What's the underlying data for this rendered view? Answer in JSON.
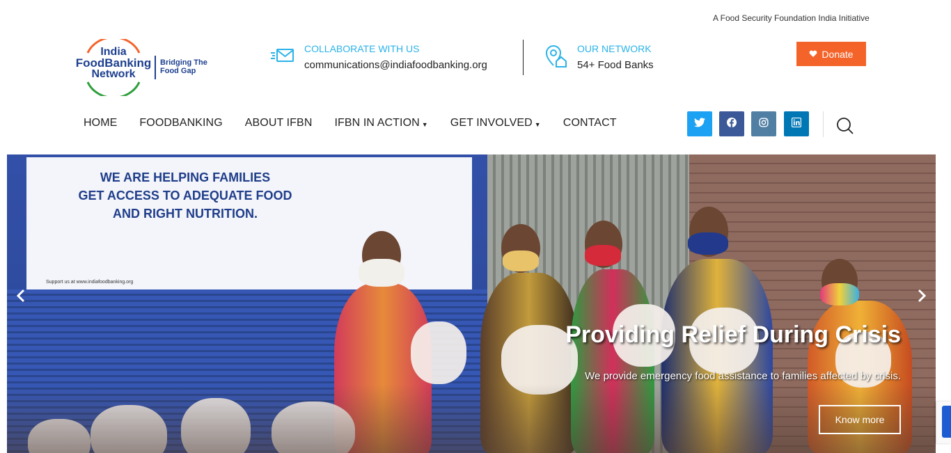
{
  "header": {
    "tagline": "A Food Security Foundation India Initiative",
    "logo": {
      "line1": "India",
      "line2": "FoodBanking",
      "line3": "Network",
      "tag1": "Bridging The",
      "tag2": "Food Gap"
    },
    "collaborate": {
      "title": "COLLABORATE WITH US",
      "value": "communications@indiafoodbanking.org",
      "icon": "email-icon"
    },
    "network": {
      "title": "OUR NETWORK",
      "value": "54+ Food Banks",
      "icon": "location-home-icon"
    },
    "donate_label": "Donate"
  },
  "nav": {
    "items": [
      {
        "label": "HOME",
        "dropdown": false
      },
      {
        "label": "FOODBANKING",
        "dropdown": false
      },
      {
        "label": "ABOUT IFBN",
        "dropdown": false
      },
      {
        "label": "IFBN IN ACTION",
        "dropdown": true
      },
      {
        "label": "GET INVOLVED",
        "dropdown": true
      },
      {
        "label": "CONTACT",
        "dropdown": false
      }
    ],
    "social": [
      "twitter-icon",
      "facebook-icon",
      "instagram-icon",
      "linkedin-icon"
    ]
  },
  "hero": {
    "banner_lines": [
      "WE ARE HELPING FAMILIES",
      "GET ACCESS TO ADEQUATE FOOD",
      "AND RIGHT NUTRITION."
    ],
    "banner_footer": "Support us at www.indiafoodbanking.org",
    "title": "Providing Relief During Crisis",
    "subtitle": "We provide emergency food assistance to families affected by crisis.",
    "button_label": "Know more"
  },
  "colors": {
    "accent_blue": "#2ab3e8",
    "donate_orange": "#f4632a",
    "logo_navy": "#1d3f8f"
  }
}
